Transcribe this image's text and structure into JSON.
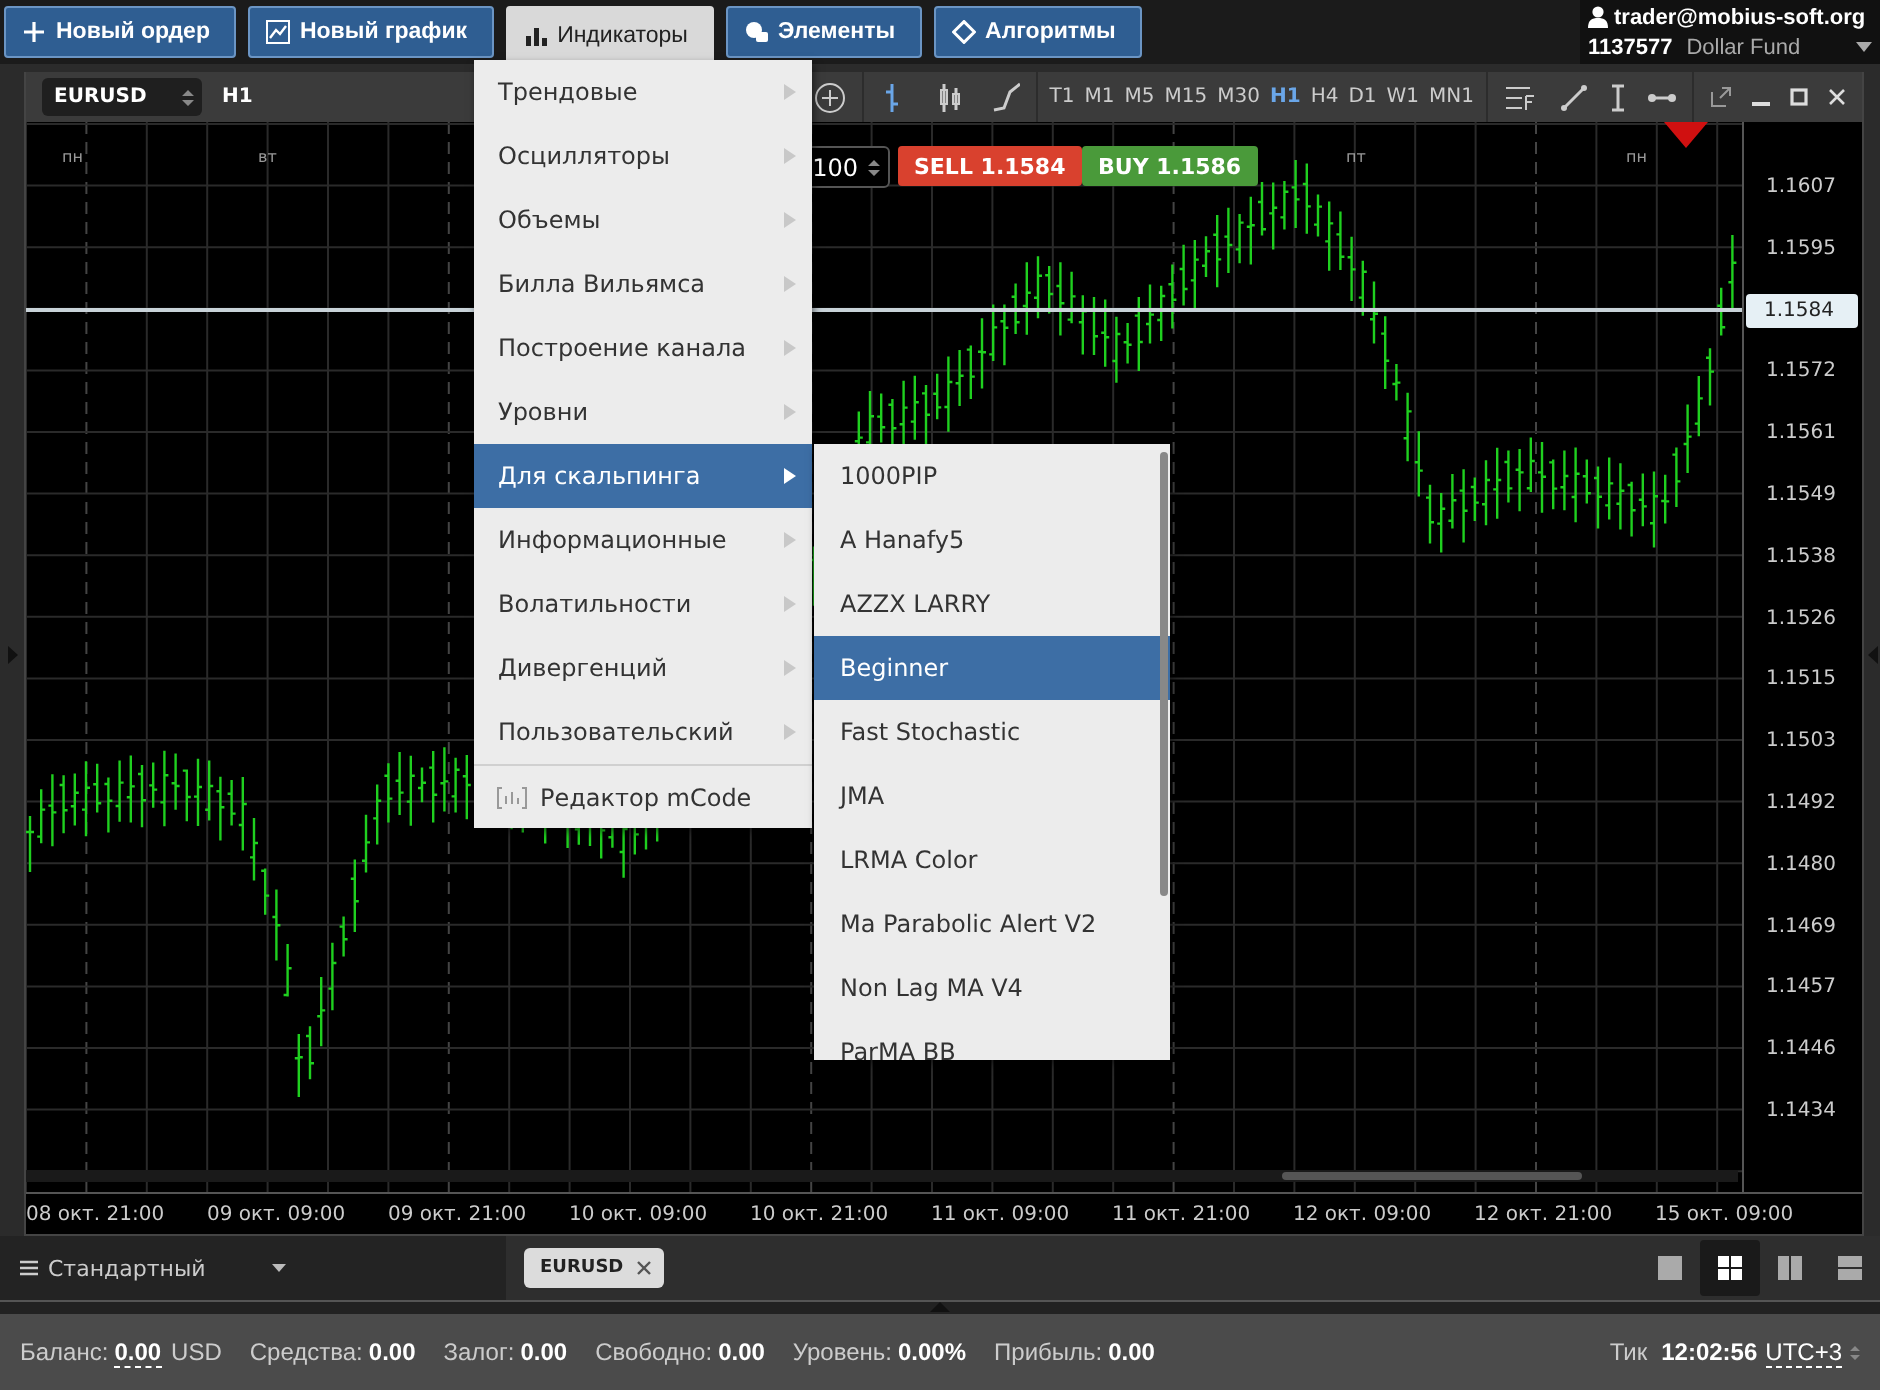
{
  "top_buttons": [
    {
      "label": "Новый ордер",
      "selected": false
    },
    {
      "label": "Новый график",
      "selected": false
    },
    {
      "label": "Индикаторы",
      "selected": true
    },
    {
      "label": "Элементы",
      "selected": false
    },
    {
      "label": "Алгоритмы",
      "selected": false
    }
  ],
  "account": {
    "user": "trader@mobius-soft.org",
    "number": "1137577",
    "name": "Dollar Fund"
  },
  "chart": {
    "symbol": "EURUSD",
    "timeframe": "H1",
    "bar_styles": [
      {
        "kind": "bars",
        "selected": true
      },
      {
        "kind": "candles",
        "selected": false
      },
      {
        "kind": "line",
        "selected": false
      }
    ],
    "timeframes": [
      {
        "label": "T1",
        "selected": false
      },
      {
        "label": "M1",
        "selected": false
      },
      {
        "label": "M5",
        "selected": false
      },
      {
        "label": "M15",
        "selected": false
      },
      {
        "label": "M30",
        "selected": false
      },
      {
        "label": "H1",
        "selected": true
      },
      {
        "label": "H4",
        "selected": false
      },
      {
        "label": "D1",
        "selected": false
      },
      {
        "label": "W1",
        "selected": false
      },
      {
        "label": "MN1",
        "selected": false
      }
    ],
    "day_labels": [
      "пн",
      "вт",
      "пт",
      "пн"
    ],
    "volume": "100",
    "sell": {
      "label": "SELL",
      "price": "1.1584"
    },
    "buy": {
      "label": "BUY",
      "price": "1.1586"
    },
    "price_labels": [
      "1.1607",
      "1.1595",
      "1.1572",
      "1.1561",
      "1.1549",
      "1.1538",
      "1.1526",
      "1.1515",
      "1.1503",
      "1.1492",
      "1.1480",
      "1.1469",
      "1.1457",
      "1.1446",
      "1.1434"
    ],
    "current_price": "1.1584",
    "time_labels": [
      "08 окт. 21:00",
      "09 окт. 09:00",
      "09 окт. 21:00",
      "10 окт. 09:00",
      "10 окт. 21:00",
      "11 окт. 09:00",
      "11 окт. 21:00",
      "12 окт. 09:00",
      "12 окт. 21:00",
      "15 окт. 09:00"
    ]
  },
  "indicators_menu": {
    "items": [
      {
        "label": "Трендовые",
        "selected": false
      },
      {
        "label": "Осцилляторы",
        "selected": false
      },
      {
        "label": "Объемы",
        "selected": false
      },
      {
        "label": "Билла Вильямса",
        "selected": false
      },
      {
        "label": "Построение канала",
        "selected": false
      },
      {
        "label": "Уровни",
        "selected": false
      },
      {
        "label": "Для скальпинга",
        "selected": true
      },
      {
        "label": "Информационные",
        "selected": false
      },
      {
        "label": "Волатильности",
        "selected": false
      },
      {
        "label": "Дивергенций",
        "selected": false
      },
      {
        "label": "Пользовательский",
        "selected": false
      }
    ],
    "editor": "Редактор mCode"
  },
  "submenu": {
    "items": [
      {
        "label": "1000PIP",
        "selected": false
      },
      {
        "label": "A Hanafy5",
        "selected": false
      },
      {
        "label": "AZZX LARRY",
        "selected": false
      },
      {
        "label": "Beginner",
        "selected": true
      },
      {
        "label": "Fast Stochastic",
        "selected": false
      },
      {
        "label": "JMA",
        "selected": false
      },
      {
        "label": "LRMA Color",
        "selected": false
      },
      {
        "label": "Ma Parabolic Alert V2",
        "selected": false
      },
      {
        "label": "Non Lag MA V4",
        "selected": false
      },
      {
        "label": "ParMA BB",
        "selected": false
      }
    ]
  },
  "bottom": {
    "workspace": "Стандартный",
    "tabs": [
      {
        "label": "EURUSD"
      }
    ],
    "layouts": [
      {
        "kind": "single",
        "selected": false
      },
      {
        "kind": "grid",
        "selected": true
      },
      {
        "kind": "columns",
        "selected": false
      },
      {
        "kind": "rows",
        "selected": false
      }
    ]
  },
  "status": {
    "fields": [
      {
        "label": "Баланс:",
        "value": "0.00",
        "unit": "USD",
        "dotted": true
      },
      {
        "label": "Средства:",
        "value": "0.00",
        "dotted": false
      },
      {
        "label": "Залог:",
        "value": "0.00",
        "dotted": false
      },
      {
        "label": "Свободно:",
        "value": "0.00",
        "dotted": false
      },
      {
        "label": "Уровень:",
        "value": "0.00%",
        "dotted": false
      },
      {
        "label": "Прибыль:",
        "value": "0.00",
        "dotted": false
      }
    ],
    "tick_label": "Тик",
    "time": "12:02:56",
    "timezone": "UTC+3"
  }
}
